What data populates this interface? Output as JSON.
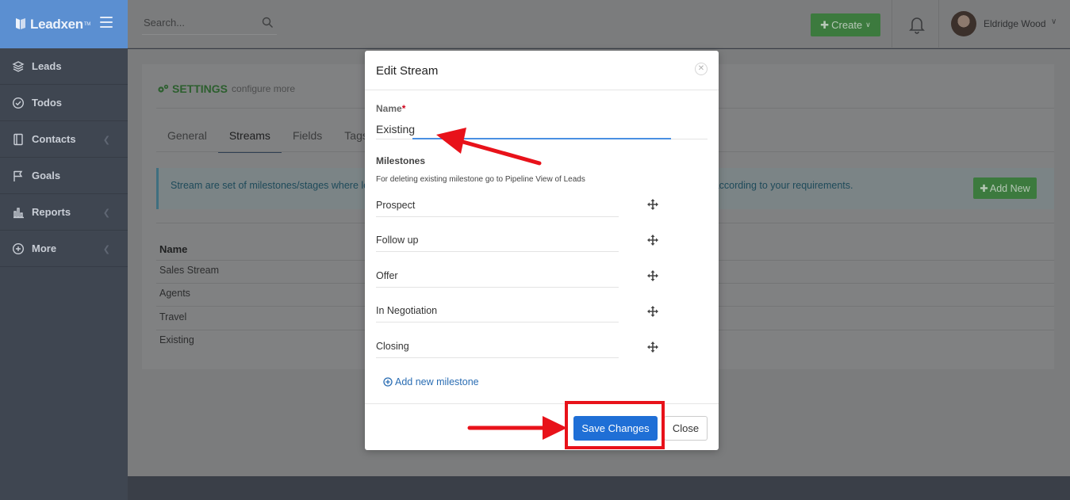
{
  "app": {
    "name": "Leadxen",
    "trademark": "TM"
  },
  "sidebar": {
    "items": [
      {
        "label": "Leads",
        "icon": "layers-icon",
        "has_children": false
      },
      {
        "label": "Todos",
        "icon": "check-circle-icon",
        "has_children": false
      },
      {
        "label": "Contacts",
        "icon": "address-book-icon",
        "has_children": true
      },
      {
        "label": "Goals",
        "icon": "flag-icon",
        "has_children": false
      },
      {
        "label": "Reports",
        "icon": "bar-chart-icon",
        "has_children": true
      },
      {
        "label": "More",
        "icon": "plus-circle-icon",
        "has_children": true
      }
    ]
  },
  "topbar": {
    "search_placeholder": "Search...",
    "create_label": "Create",
    "user_name": "Eldridge Wood"
  },
  "settings": {
    "title": "SETTINGS",
    "subtitle": "configure more",
    "tabs": [
      "General",
      "Streams",
      "Fields",
      "Tags"
    ],
    "active_tab": "Streams",
    "info_text_left": "Stream are set of milestones/stages where le",
    "info_text_right": "s according to your requirements.",
    "add_new_label": "Add New",
    "table": {
      "header": "Name",
      "rows": [
        "Sales Stream",
        "Agents",
        "Travel",
        "Existing"
      ]
    }
  },
  "modal": {
    "title": "Edit Stream",
    "name_label": "Name",
    "required_mark": "*",
    "name_value": "Existing",
    "milestones_title": "Milestones",
    "milestones_hint": "For deleting existing milestone go to Pipeline View of Leads",
    "milestones": [
      "Prospect",
      "Follow up",
      "Offer",
      "In Negotiation",
      "Closing"
    ],
    "add_milestone_label": "Add new milestone",
    "save_label": "Save Changes",
    "close_label": "Close"
  },
  "colors": {
    "brand": "#5b8fd1",
    "primary_button": "#1f6fd6",
    "annotation": "#e8121a",
    "input_focus": "#4a90e2"
  }
}
